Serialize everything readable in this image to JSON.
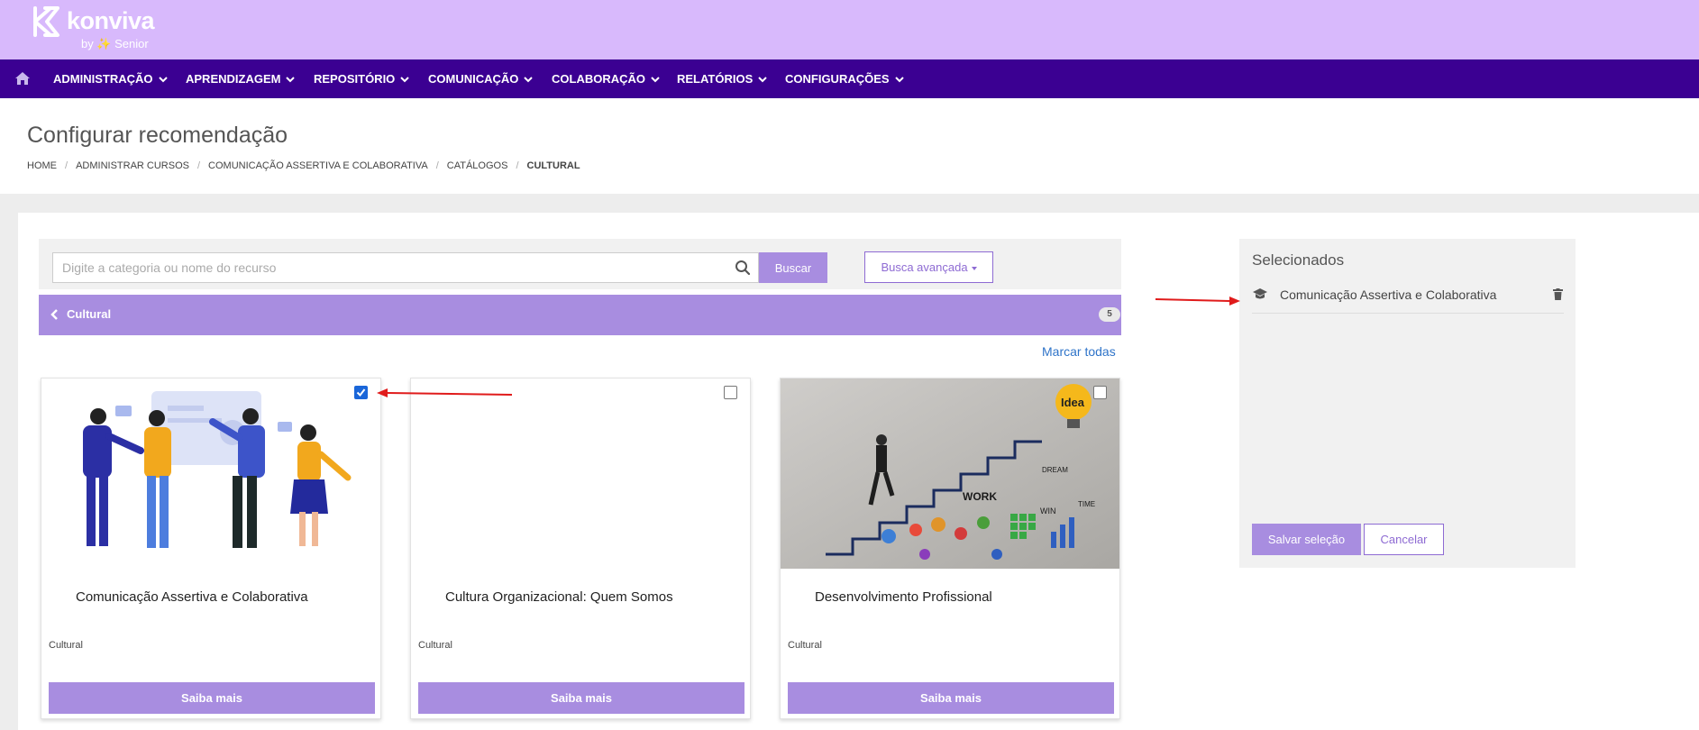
{
  "brand": {
    "name": "konviva",
    "byline": "by ✨ Senior"
  },
  "nav": {
    "items": [
      {
        "label": "ADMINISTRAÇÃO"
      },
      {
        "label": "APRENDIZAGEM"
      },
      {
        "label": "REPOSITÓRIO"
      },
      {
        "label": "COMUNICAÇÃO"
      },
      {
        "label": "COLABORAÇÃO"
      },
      {
        "label": "RELATÓRIOS"
      },
      {
        "label": "CONFIGURAÇÕES"
      }
    ]
  },
  "page": {
    "title": "Configurar recomendação",
    "breadcrumb": [
      "HOME",
      "ADMINISTRAR CURSOS",
      "COMUNICAÇÃO ASSERTIVA E COLABORATIVA",
      "CATÁLOGOS",
      "CULTURAL"
    ]
  },
  "search": {
    "placeholder": "Digite a categoria ou nome do recurso",
    "value": "",
    "button_label": "Buscar",
    "advanced_label": "Busca avançada"
  },
  "category": {
    "label": "Cultural",
    "count": "5"
  },
  "mark_all_label": "Marcar todas",
  "cards": [
    {
      "title": "Comunicação Assertiva e Colaborativa",
      "category": "Cultural",
      "button": "Saiba mais",
      "checked": true,
      "image": "team-collaboration-illustration"
    },
    {
      "title": "Cultura Organizacional: Quem Somos",
      "category": "Cultural",
      "button": "Saiba mais",
      "checked": false,
      "image": "blank"
    },
    {
      "title": "Desenvolvimento Profissional",
      "category": "Cultural",
      "button": "Saiba mais",
      "checked": false,
      "image": "stairs-idea-photo"
    }
  ],
  "image_text": {
    "idea": "Idea",
    "work": "WORK",
    "dream": "DREAM",
    "win": "WIN",
    "time": "TIME"
  },
  "selected": {
    "title": "Selecionados",
    "items": [
      {
        "label": "Comunicação Assertiva e Colaborativa",
        "icon": "graduation-cap-icon"
      }
    ],
    "save_label": "Salvar seleção",
    "cancel_label": "Cancelar"
  },
  "colors": {
    "header_bg": "#d8b9fc",
    "nav_bg": "#3b0092",
    "accent": "#a88de0",
    "link": "#2f74c9",
    "annotation": "#e01b1b"
  }
}
